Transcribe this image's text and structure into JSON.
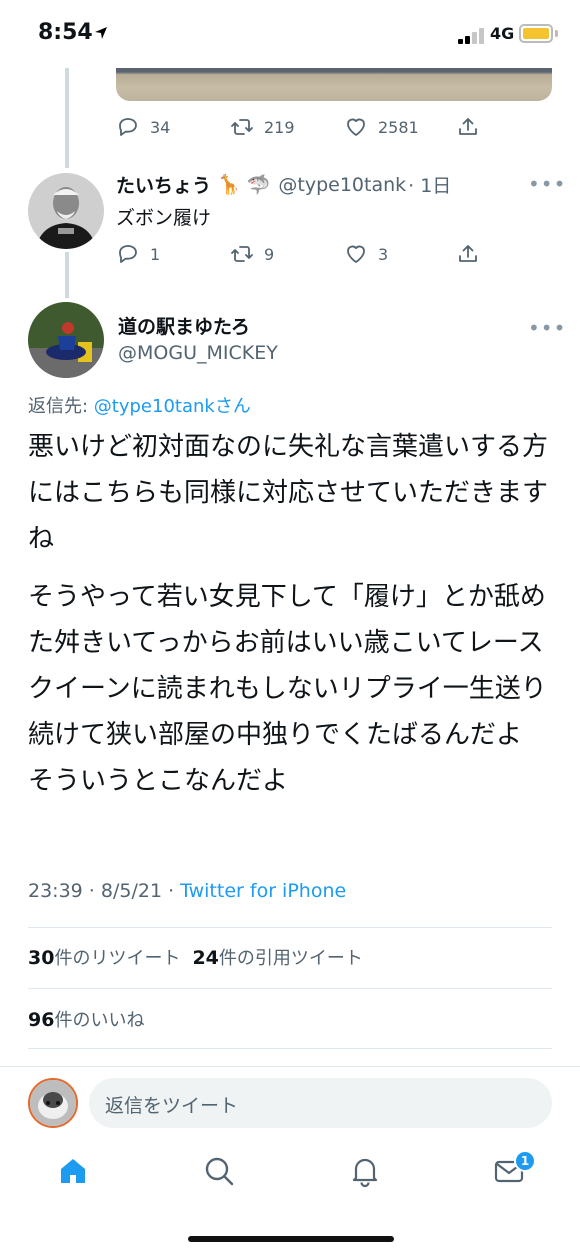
{
  "status_bar": {
    "time": "8:54",
    "network": "4G"
  },
  "previous_tweet": {
    "actions": {
      "replies": "34",
      "retweets": "219",
      "likes": "2581"
    }
  },
  "reply_tweet": {
    "name": "たいちょう",
    "emojis": "🦒 🦈",
    "handle": "@type10tank",
    "time": "· 1日",
    "text": "ズボン履け",
    "actions": {
      "replies": "1",
      "retweets": "9",
      "likes": "3"
    }
  },
  "main_tweet": {
    "name": "道の駅まゆたろ",
    "handle": "@MOGU_MICKEY",
    "replying_label": "返信先: ",
    "replying_to": "@type10tankさん",
    "paragraph1": "悪いけど初対面なのに失礼な言葉遣いする方にはこちらも同様に対応させていただきますね",
    "paragraph2": "そうやって若い女見下して「履け」とか舐めた舛きいてっからお前はいい歳こいてレースクイーンに読まれもしないリプライ一生送り続けて狭い部屋の中独りでくたばるんだよ　そういうとこなんだよ",
    "timestamp": "23:39 · 8/5/21 · ",
    "source": "Twitter for iPhone"
  },
  "stats": {
    "retweet_count": "30",
    "retweet_label": "件のリツイート",
    "quote_count": "24",
    "quote_label": "件の引用ツイート",
    "like_count": "96",
    "like_label": "件のいいね"
  },
  "reply_box": {
    "placeholder": "返信をツイート"
  },
  "tab_bar": {
    "messages_badge": "1"
  },
  "colors": {
    "accent": "#1d9bf0",
    "secondary_text": "#536471"
  }
}
